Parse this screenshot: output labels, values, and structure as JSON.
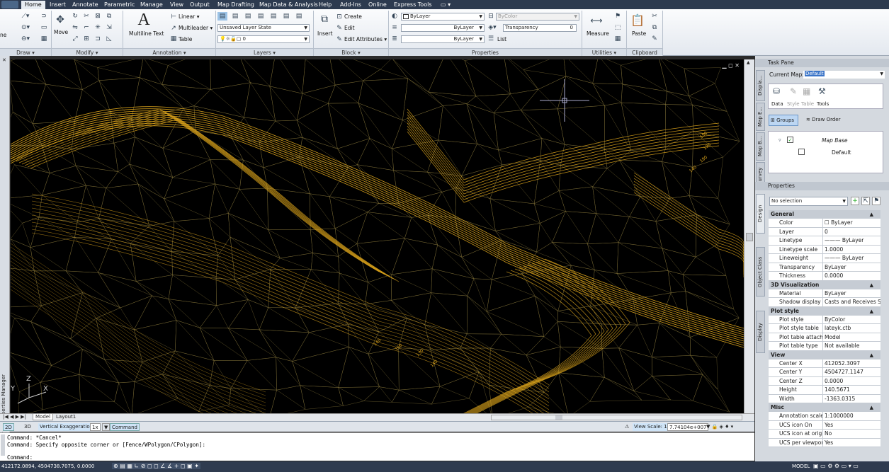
{
  "tabs": [
    {
      "label": "Home",
      "active": true
    },
    {
      "label": "Insert"
    },
    {
      "label": "Annotate"
    },
    {
      "label": "Parametric"
    },
    {
      "label": "Manage"
    },
    {
      "label": "View"
    },
    {
      "label": "Output"
    },
    {
      "label": "Map Drafting"
    },
    {
      "label": "Map Data & Analysis"
    },
    {
      "label": "Help"
    },
    {
      "label": "Add-Ins"
    },
    {
      "label": "Online"
    },
    {
      "label": "Express Tools"
    }
  ],
  "ribbon": {
    "panels": {
      "draw": "Draw ▾",
      "modify": "Modify ▾",
      "annotation": "Annotation ▾",
      "layers": "Layers ▾",
      "block": "Block ▾",
      "properties": "Properties",
      "utilities": "Utilities ▾",
      "clipboard": "Clipboard"
    },
    "draw_tail": "ne",
    "move_label": "Move",
    "multiline_text": "Multiline Text",
    "linear": "Linear ▾",
    "multileader": "Multileader ▾",
    "table": "Table",
    "layer_state": "Unsaved Layer State",
    "layer_current": "0",
    "insert_label": "Insert",
    "create": "Create",
    "edit": "Edit",
    "edit_attributes": "Edit Attributes ▾",
    "color_combo": "ByLayer",
    "linetype_combo": "ByLayer",
    "lineweight_combo": "ByLayer",
    "bycolor": "ByColor",
    "transparency_label": "Transparency",
    "transparency_value": "0",
    "list_label": "List",
    "measure_label": "Measure",
    "paste_label": "Paste"
  },
  "left_palette": "Layer Properties Manager",
  "canvas": {
    "contour_labels": [
      "180",
      "190",
      "180",
      "140",
      "150",
      "130",
      "140",
      "140"
    ],
    "ucs": {
      "y": "Y",
      "z": "Z",
      "x": "X"
    },
    "window_controls": "▁ ◻ ✕"
  },
  "layout_tabs": [
    "Model",
    "Layout1"
  ],
  "status_a": {
    "mode_2d": "2D",
    "mode_3d": "3D",
    "vert_exag_label": "Vertical Exaggeration:",
    "vert_exag_value": "1x",
    "command_btn": "Command",
    "view_scale_label": "View Scale: 1",
    "view_scale_value": "7.74104e+007"
  },
  "command_window": {
    "lines": [
      "Command: *Cancel*",
      "Command: Specify opposite corner or [Fence/WPolygon/CPolygon]:"
    ],
    "prompt": "Command:"
  },
  "status_b": {
    "coords": "412172.0894, 4504738.7075, 0.0000",
    "model": "MODEL"
  },
  "task_pane": {
    "title": "Task Pane",
    "current_map_label": "Current Map:",
    "current_map_value": "Default",
    "buttons": [
      "Data",
      "Style",
      "Table",
      "Tools"
    ],
    "groups": "Groups",
    "draw_order": "Draw Order",
    "tree": [
      "Map Base",
      "Default"
    ],
    "side_tabs": [
      "Displa...",
      "Map E...",
      "Map B...",
      "Survey"
    ]
  },
  "properties": {
    "title": "Properties",
    "selection": "No selection",
    "side_tabs": [
      "Design",
      "Object Class",
      "Display"
    ],
    "categories": [
      {
        "name": "General",
        "rows": [
          [
            "Color",
            "ByLayer"
          ],
          [
            "Layer",
            "0"
          ],
          [
            "Linetype",
            "——— ByLayer"
          ],
          [
            "Linetype scale",
            "1.0000"
          ],
          [
            "Lineweight",
            "——— ByLayer"
          ],
          [
            "Transparency",
            "ByLayer"
          ],
          [
            "Thickness",
            "0.0000"
          ]
        ]
      },
      {
        "name": "3D Visualization",
        "rows": [
          [
            "Material",
            "ByLayer"
          ],
          [
            "Shadow display",
            "Casts and Receives S..."
          ]
        ]
      },
      {
        "name": "Plot style",
        "rows": [
          [
            "Plot style",
            "ByColor"
          ],
          [
            "Plot style table",
            "lateyk.ctb"
          ],
          [
            "Plot table attach...",
            "Model"
          ],
          [
            "Plot table type",
            "Not available"
          ]
        ]
      },
      {
        "name": "View",
        "rows": [
          [
            "Center X",
            "412052.3097"
          ],
          [
            "Center Y",
            "4504727.1147"
          ],
          [
            "Center Z",
            "0.0000"
          ],
          [
            "Height",
            "140.5671"
          ],
          [
            "Width",
            "-1363.0315"
          ]
        ]
      },
      {
        "name": "Misc",
        "rows": [
          [
            "Annotation scale",
            "1:1000000"
          ],
          [
            "UCS icon On",
            "Yes"
          ],
          [
            "UCS icon at origin",
            "No"
          ],
          [
            "UCS per viewport",
            "Yes"
          ]
        ]
      }
    ]
  },
  "colors": {
    "contour": "#d9a21b",
    "tin": "#8a7a3c",
    "canvas": "#000000",
    "tabbar": "#2d3a4f"
  }
}
